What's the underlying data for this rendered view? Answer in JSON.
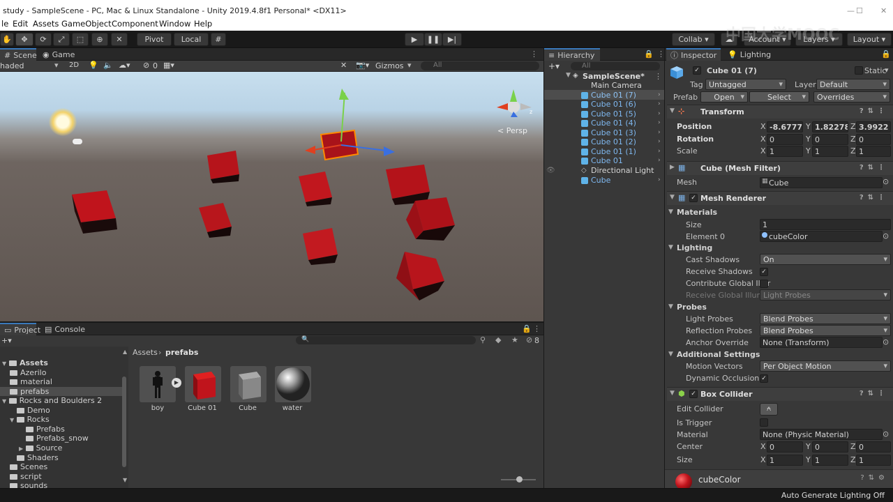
{
  "title_bar": {
    "text": "study - SampleScene - PC, Mac & Linux Standalone - Unity 2019.4.8f1 Personal* <DX11>"
  },
  "menu": [
    "le",
    "Edit",
    "Assets",
    "GameObject",
    "Component",
    "Window",
    "Help"
  ],
  "toolbar": {
    "pivot": "Pivot",
    "local": "Local",
    "collab": "Collab ▾",
    "account": "Account",
    "layers": "Layers",
    "layout": "Layout"
  },
  "scene_tabs": {
    "scene": "Scene",
    "game": "Game"
  },
  "scene_bar": {
    "shading": "haded",
    "mode2d": "2D",
    "gizmo_count": "0",
    "gizmos": "Gizmos",
    "search_placeholder": "All"
  },
  "scene_view": {
    "persp": "< Persp"
  },
  "hierarchy": {
    "tab": "Hierarchy",
    "search_placeholder": "All",
    "scene": "SampleScene*",
    "items": [
      "Main Camera",
      "Cube 01 (7)",
      "Cube 01 (6)",
      "Cube 01 (5)",
      "Cube 01 (4)",
      "Cube 01 (3)",
      "Cube 01 (2)",
      "Cube 01 (1)",
      "Cube 01",
      "Directional Light",
      "Cube"
    ]
  },
  "inspector": {
    "tab": "Inspector",
    "tab2": "Lighting",
    "object_name": "Cube 01 (7)",
    "static": "Static",
    "tag_label": "Tag",
    "tag": "Untagged",
    "layer_label": "Layer",
    "layer": "Default",
    "prefab_label": "Prefab",
    "open": "Open",
    "select": "Select",
    "overrides": "Overrides",
    "transform": {
      "title": "Transform",
      "position_label": "Position",
      "position": [
        "-8.67779",
        "1.822783",
        "3.9922"
      ],
      "rotation_label": "Rotation",
      "rotation": [
        "0",
        "0",
        "0"
      ],
      "scale_label": "Scale",
      "scale": [
        "1",
        "1",
        "1"
      ]
    },
    "mesh_filter": {
      "title": "Cube (Mesh Filter)",
      "mesh_label": "Mesh",
      "mesh": "Cube"
    },
    "mesh_renderer": {
      "title": "Mesh Renderer",
      "materials": "Materials",
      "size_label": "Size",
      "size": "1",
      "element_label": "Element 0",
      "element": "cubeColor",
      "lighting": "Lighting",
      "cast_label": "Cast Shadows",
      "cast": "On",
      "receive_label": "Receive Shadows",
      "contrib_label": "Contribute Global Illur",
      "receive_gi_label": "Receive Global Illumin",
      "receive_gi": "Light Probes",
      "probes": "Probes",
      "light_probes_label": "Light Probes",
      "light_probes": "Blend Probes",
      "refl_label": "Reflection Probes",
      "refl": "Blend Probes",
      "anchor_label": "Anchor Override",
      "anchor": "None (Transform)",
      "additional": "Additional Settings",
      "motion_label": "Motion Vectors",
      "motion": "Per Object Motion",
      "dyn_label": "Dynamic Occlusion"
    },
    "box_collider": {
      "title": "Box Collider",
      "edit_label": "Edit Collider",
      "trigger_label": "Is Trigger",
      "material_label": "Material",
      "material": "None (Physic Material)",
      "center_label": "Center",
      "center": [
        "0",
        "0",
        "0"
      ],
      "size_label": "Size",
      "size": [
        "1",
        "1",
        "1"
      ]
    },
    "material_preview": "cubeColor"
  },
  "project": {
    "tab": "Project",
    "tab2": "Console",
    "breadcrumb": [
      "Assets",
      "prefabs"
    ],
    "tree": [
      "Assets",
      "Azerilo",
      "material",
      "prefabs",
      "Rocks and Boulders 2",
      "Demo",
      "Rocks",
      "Prefabs",
      "Prefabs_snow",
      "Source",
      "Shaders",
      "Scenes",
      "script",
      "sounds"
    ],
    "assets": [
      "boy",
      "Cube 01",
      "Cube",
      "water"
    ],
    "hidden_count": "8"
  },
  "status": {
    "right": "Auto Generate Lighting Off"
  },
  "watermark": "中国大学MOOC",
  "colors": {
    "accent": "#3a79bb",
    "cube_red": "#c0141c",
    "prefab_blue": "#7fb8f0"
  }
}
